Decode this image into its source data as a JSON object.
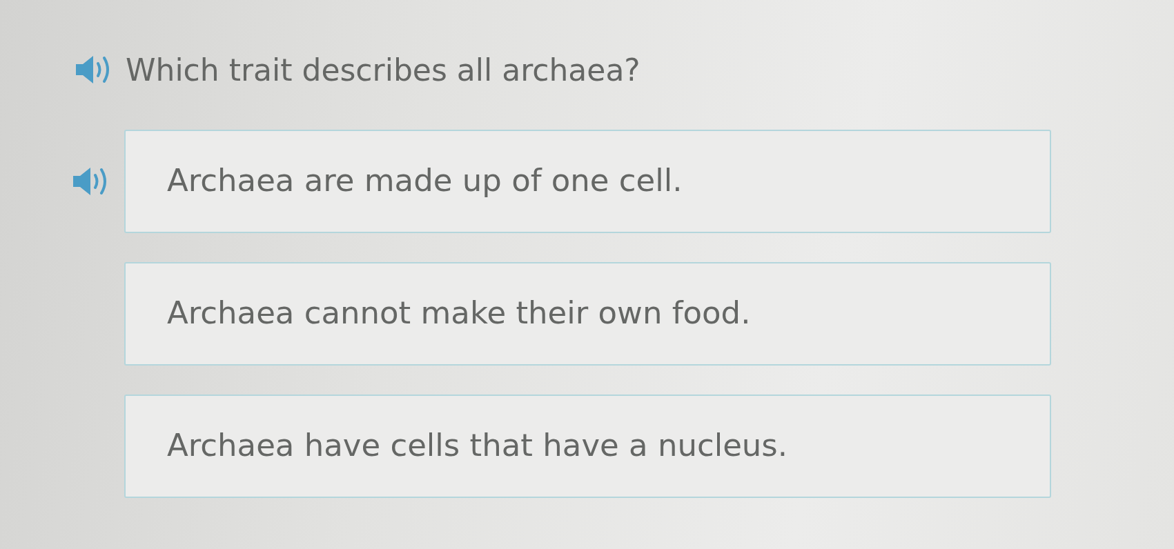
{
  "question": {
    "text": "Which trait describes all archaea?",
    "audio": true
  },
  "options": [
    {
      "text": "Archaea are made up of one cell.",
      "audio": true,
      "selected": false
    },
    {
      "text": "Archaea cannot make their own food.",
      "audio": false,
      "selected": false
    },
    {
      "text": "Archaea have cells that have a nucleus.",
      "audio": false,
      "selected": false
    }
  ]
}
